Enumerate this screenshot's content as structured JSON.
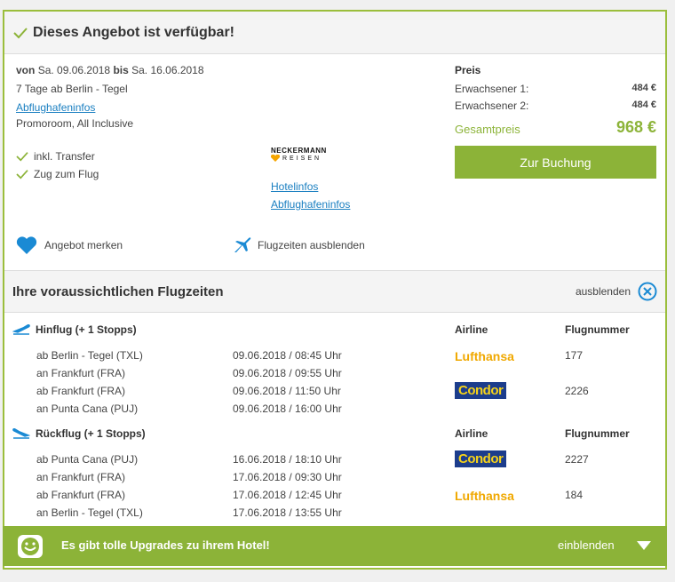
{
  "header": {
    "title": "Dieses Angebot ist verfügbar!"
  },
  "offer": {
    "von_label": "von",
    "from_date": "Sa. 09.06.2018",
    "bis_label": "bis",
    "to_date": "Sa. 16.06.2018",
    "duration": "7 Tage ab Berlin - Tegel",
    "airport_info_link": "Abflughafeninfos",
    "room": "Promoroom, All Inclusive",
    "features": [
      "inkl. Transfer",
      "Zug zum Flug"
    ],
    "operator_logo": {
      "line1": "NECKERMANN",
      "line2": "REISEN"
    },
    "hotel_info_link": "Hotelinfos",
    "airport_info_link2": "Abflughafeninfos",
    "remember_label": "Angebot merken",
    "hide_flight_times_label": "Flugzeiten ausblenden"
  },
  "price": {
    "title": "Preis",
    "rows": [
      {
        "label": "Erwachsener 1:",
        "value": "484 €"
      },
      {
        "label": "Erwachsener 2:",
        "value": "484 €"
      }
    ],
    "total_label": "Gesamtpreis",
    "total_value": "968 €",
    "book_button": "Zur Buchung"
  },
  "flights": {
    "section_title": "Ihre voraussichtlichen Flugzeiten",
    "hide_label": "ausblenden",
    "col_airline": "Airline",
    "col_flightno": "Flugnummer",
    "outbound": {
      "title": "Hinflug (+ 1 Stopps)",
      "legs": [
        {
          "place": "ab Berlin - Tegel (TXL)",
          "time": "09.06.2018 / 08:45 Uhr"
        },
        {
          "place": "an Frankfurt (FRA)",
          "time": "09.06.2018 / 09:55 Uhr"
        },
        {
          "place": "ab Frankfurt (FRA)",
          "time": "09.06.2018 / 11:50 Uhr"
        },
        {
          "place": "an Punta Cana (PUJ)",
          "time": "09.06.2018 / 16:00 Uhr"
        }
      ],
      "airlines": [
        {
          "name": "Lufthansa",
          "flight": "177"
        },
        {
          "name": "Condor",
          "flight": "2226"
        }
      ]
    },
    "return": {
      "title": "Rückflug (+ 1 Stopps)",
      "legs": [
        {
          "place": "ab Punta Cana (PUJ)",
          "time": "16.06.2018 / 18:10 Uhr"
        },
        {
          "place": "an Frankfurt (FRA)",
          "time": "17.06.2018 / 09:30 Uhr"
        },
        {
          "place": "ab Frankfurt (FRA)",
          "time": "17.06.2018 / 12:45 Uhr"
        },
        {
          "place": "an Berlin - Tegel (TXL)",
          "time": "17.06.2018 / 13:55 Uhr"
        }
      ],
      "airlines": [
        {
          "name": "Condor",
          "flight": "2227"
        },
        {
          "name": "Lufthansa",
          "flight": "184"
        }
      ]
    }
  },
  "footer": {
    "text": "Es gibt tolle Upgrades zu ihrem Hotel!",
    "action": "einblenden"
  }
}
